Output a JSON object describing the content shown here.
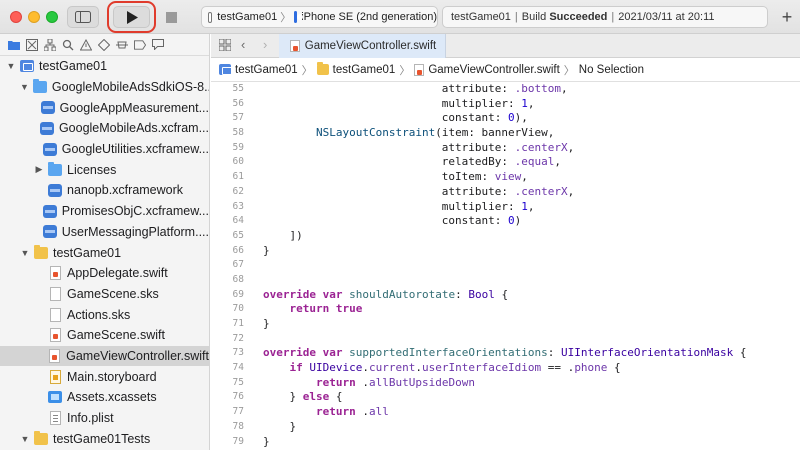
{
  "toolbar": {
    "scheme_project": "testGame01",
    "scheme_device": "iPhone SE (2nd generation)",
    "status_project": "testGame01",
    "status_build_prefix": "Build",
    "status_build_result": "Succeeded",
    "status_timestamp": "2021/03/11 at 20:11",
    "add_label": "+"
  },
  "navigator": {
    "items": [
      {
        "label": "testGame01",
        "indent": 0,
        "disclosure": "▼",
        "icon": "project-icon"
      },
      {
        "label": "GoogleMobileAdsSdkiOS-8...",
        "indent": 1,
        "disclosure": "▼",
        "icon": "folder-blue-icon"
      },
      {
        "label": "GoogleAppMeasurement...",
        "indent": 2,
        "disclosure": "",
        "icon": "framework-icon"
      },
      {
        "label": "GoogleMobileAds.xcfram...",
        "indent": 2,
        "disclosure": "",
        "icon": "framework-icon"
      },
      {
        "label": "GoogleUtilities.xcframew...",
        "indent": 2,
        "disclosure": "",
        "icon": "framework-icon"
      },
      {
        "label": "Licenses",
        "indent": 2,
        "disclosure": "▶",
        "icon": "folder-blue-icon"
      },
      {
        "label": "nanopb.xcframework",
        "indent": 2,
        "disclosure": "",
        "icon": "framework-icon"
      },
      {
        "label": "PromisesObjC.xcframew...",
        "indent": 2,
        "disclosure": "",
        "icon": "framework-icon"
      },
      {
        "label": "UserMessagingPlatform....",
        "indent": 2,
        "disclosure": "",
        "icon": "framework-icon"
      },
      {
        "label": "testGame01",
        "indent": 1,
        "disclosure": "▼",
        "icon": "folder-yellow-icon"
      },
      {
        "label": "AppDelegate.swift",
        "indent": 2,
        "disclosure": "",
        "icon": "swift-file-icon"
      },
      {
        "label": "GameScene.sks",
        "indent": 2,
        "disclosure": "",
        "icon": "document-icon"
      },
      {
        "label": "Actions.sks",
        "indent": 2,
        "disclosure": "",
        "icon": "document-icon"
      },
      {
        "label": "GameScene.swift",
        "indent": 2,
        "disclosure": "",
        "icon": "swift-file-icon"
      },
      {
        "label": "GameViewController.swift",
        "indent": 2,
        "disclosure": "",
        "icon": "swift-file-icon",
        "selected": true
      },
      {
        "label": "Main.storyboard",
        "indent": 2,
        "disclosure": "",
        "icon": "storyboard-icon"
      },
      {
        "label": "Assets.xcassets",
        "indent": 2,
        "disclosure": "",
        "icon": "assets-icon"
      },
      {
        "label": "Info.plist",
        "indent": 2,
        "disclosure": "",
        "icon": "plist-icon"
      },
      {
        "label": "testGame01Tests",
        "indent": 1,
        "disclosure": "▼",
        "icon": "folder-yellow-icon"
      }
    ]
  },
  "editor": {
    "tab_label": "GameViewController.swift",
    "back_glyph": "‹",
    "forward_glyph": "›",
    "jumpbar": {
      "project": "testGame01",
      "group": "testGame01",
      "file": "GameViewController.swift",
      "selection": "No Selection"
    },
    "lines": [
      {
        "n": "55",
        "html": "                           attribute: <span class=\"pr\">.bottom</span>,"
      },
      {
        "n": "56",
        "html": "                           multiplier: <span class=\"nm\">1</span>,"
      },
      {
        "n": "57",
        "html": "                           constant: <span class=\"nm\">0</span>),"
      },
      {
        "n": "58",
        "html": "        <span class=\"ty\">NSLayoutConstraint</span>(item: bannerView,"
      },
      {
        "n": "59",
        "html": "                           attribute: <span class=\"pr\">.centerX</span>,"
      },
      {
        "n": "60",
        "html": "                           relatedBy: <span class=\"pr\">.equal</span>,"
      },
      {
        "n": "61",
        "html": "                           toItem: <span class=\"pr\">view</span>,"
      },
      {
        "n": "62",
        "html": "                           attribute: <span class=\"pr\">.centerX</span>,"
      },
      {
        "n": "63",
        "html": "                           multiplier: <span class=\"nm\">1</span>,"
      },
      {
        "n": "64",
        "html": "                           constant: <span class=\"nm\">0</span>)"
      },
      {
        "n": "65",
        "html": "    ])"
      },
      {
        "n": "66",
        "html": "}"
      },
      {
        "n": "67",
        "html": ""
      },
      {
        "n": "68",
        "html": ""
      },
      {
        "n": "69",
        "html": "<span class=\"kw\">override</span> <span class=\"kw\">var</span> <span class=\"fn\">shouldAutorotate</span>: <span class=\"tp\">Bool</span> {"
      },
      {
        "n": "70",
        "html": "    <span class=\"kw\">return</span> <span class=\"kw\">true</span>"
      },
      {
        "n": "71",
        "html": "}"
      },
      {
        "n": "72",
        "html": ""
      },
      {
        "n": "73",
        "html": "<span class=\"kw\">override</span> <span class=\"kw\">var</span> <span class=\"fn\">supportedInterfaceOrientations</span>: <span class=\"tp\">UIInterfaceOrientationMask</span> {"
      },
      {
        "n": "74",
        "html": "    <span class=\"kw\">if</span> <span class=\"tp\">UIDevice</span>.<span class=\"pr\">current</span>.<span class=\"pr\">userInterfaceIdiom</span> == .<span class=\"pr\">phone</span> {"
      },
      {
        "n": "75",
        "html": "        <span class=\"kw\">return</span> .<span class=\"pr\">allButUpsideDown</span>"
      },
      {
        "n": "76",
        "html": "    } <span class=\"kw\">else</span> {"
      },
      {
        "n": "77",
        "html": "        <span class=\"kw\">return</span> .<span class=\"pr\">all</span>"
      },
      {
        "n": "78",
        "html": "    }"
      },
      {
        "n": "79",
        "html": "}"
      }
    ]
  },
  "icons": {
    "run": "play-icon",
    "stop": "stop-icon",
    "sidebar": "sidebar-toggle-icon",
    "grid": "grid-icon"
  },
  "colors": {
    "run_highlight": "#e03b2c",
    "selected_row": "#d4d4d4",
    "keyword": "#9b2393",
    "active_tab": "#dde9f8"
  }
}
